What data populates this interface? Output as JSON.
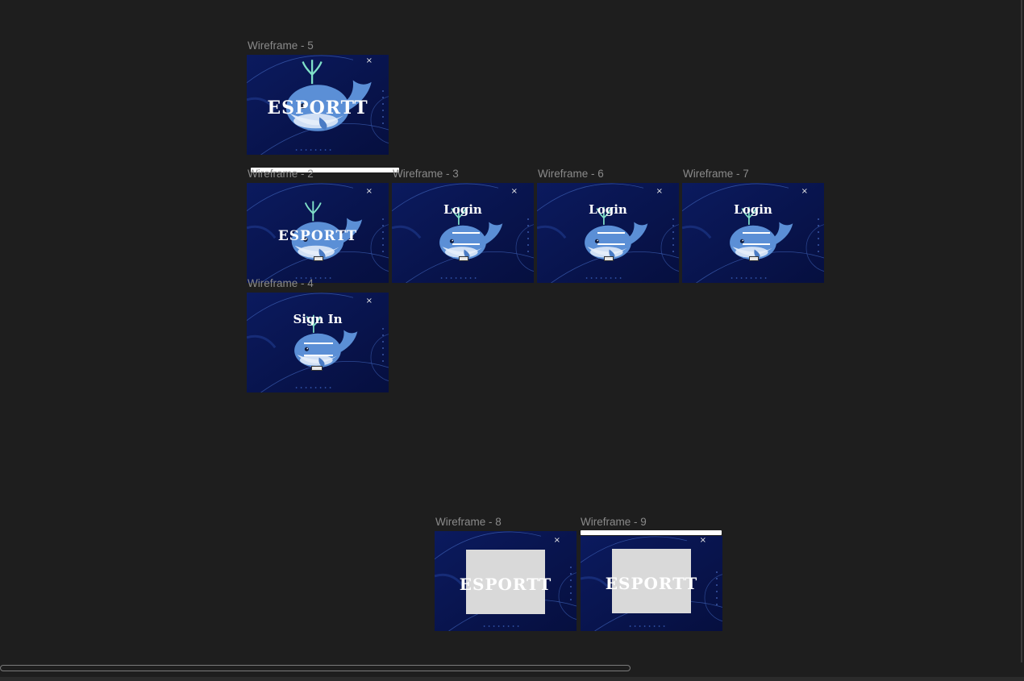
{
  "canvas": {
    "background": "#1e1e1e",
    "frame_background": "#0a1753",
    "whale_color": "#5b8fd6"
  },
  "frames": [
    {
      "id": "wf5",
      "label": "Wireframe - 5",
      "title": "ESPORTT"
    },
    {
      "id": "wf2",
      "label": "Wireframe - 2",
      "title": "ESPORTT"
    },
    {
      "id": "wf3",
      "label": "Wireframe - 3",
      "title": "Login"
    },
    {
      "id": "wf6",
      "label": "Wireframe - 6",
      "title": "Login"
    },
    {
      "id": "wf7",
      "label": "Wireframe - 7",
      "title": "Login"
    },
    {
      "id": "wf4",
      "label": "Wireframe - 4",
      "title": "Sign In"
    },
    {
      "id": "wf8",
      "label": "Wireframe - 8",
      "title": "ESPORTT"
    },
    {
      "id": "wf9",
      "label": "Wireframe - 9",
      "title": "ESPORTT"
    }
  ],
  "close_glyph": "×",
  "icons": {
    "whale": "whale-illustration",
    "close": "close-icon"
  }
}
